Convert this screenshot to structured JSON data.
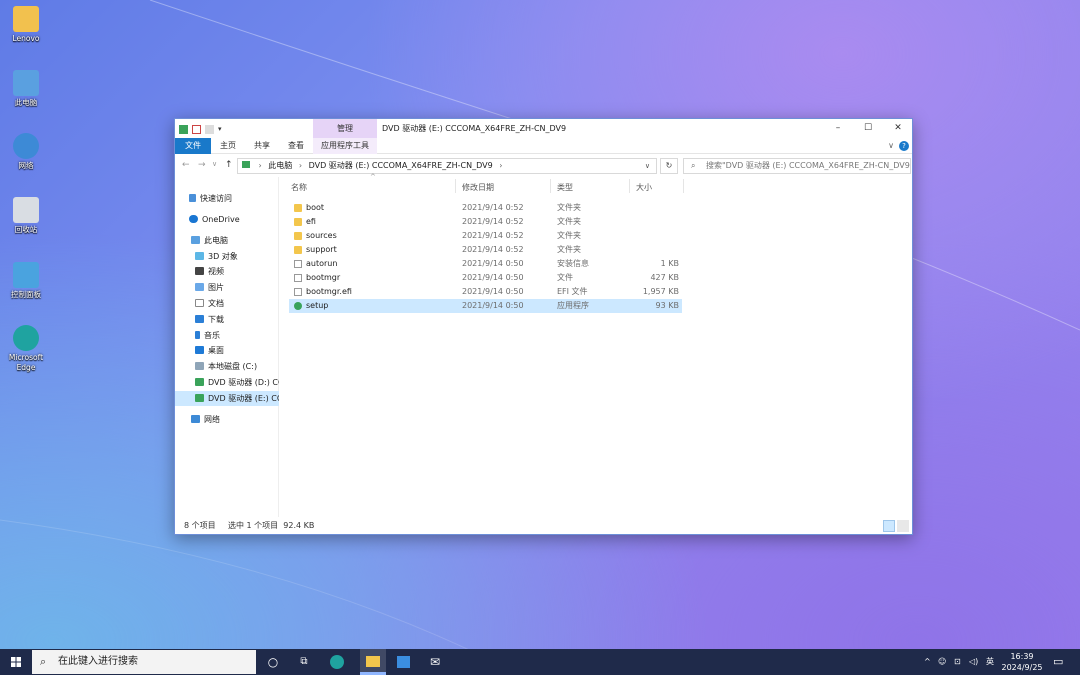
{
  "desktop": {
    "icons": [
      {
        "label": "Lenovo",
        "icon": "user-folder-icon",
        "color": "#f2c14e"
      },
      {
        "label": "此电脑",
        "icon": "computer-icon",
        "color": "#5aa0e0"
      },
      {
        "label": "网络",
        "icon": "network-globe-icon",
        "color": "#3d8ad6"
      },
      {
        "label": "回收站",
        "icon": "recycle-bin-icon",
        "color": "#d9dde3"
      },
      {
        "label": "控制面板",
        "icon": "control-panel-icon",
        "color": "#4aa3df"
      },
      {
        "label": "Microsoft Edge",
        "icon": "edge-icon",
        "color": "#1fa3a0"
      }
    ]
  },
  "window": {
    "title": "DVD 驱动器 (E:) CCCOMA_X64FRE_ZH-CN_DV9",
    "context_tab": "管理",
    "controls": {
      "minimize": "–",
      "maximize": "☐",
      "close": "✕"
    },
    "ribbon_tabs": [
      "文件",
      "主页",
      "共享",
      "查看",
      "应用程序工具"
    ],
    "ribbon_help": "?",
    "ribbon_expand": "∨",
    "address": {
      "crumbs": [
        "此电脑",
        "DVD 驱动器 (E:) CCCOMA_X64FRE_ZH-CN_DV9"
      ],
      "back": "←",
      "forward": "→",
      "recent": "∨",
      "up": "↑",
      "dropdown": "∨",
      "refresh": "↻"
    },
    "search_placeholder": "搜索\"DVD 驱动器 (E:) CCCOMA_X64FRE_ZH-CN_DV9\"",
    "nav": {
      "quick_access": "快速访问",
      "onedrive": "OneDrive",
      "this_pc": "此电脑",
      "items": [
        "3D 对象",
        "视频",
        "图片",
        "文档",
        "下载",
        "音乐",
        "桌面",
        "本地磁盘 (C:)",
        "DVD 驱动器 (D:) CC",
        "DVD 驱动器 (E:) CC"
      ],
      "network": "网络"
    },
    "columns": {
      "name": "名称",
      "modified": "修改日期",
      "type": "类型",
      "size": "大小"
    },
    "files": [
      {
        "name": "boot",
        "modified": "2021/9/14 0:52",
        "type": "文件夹",
        "size": "",
        "kind": "folder"
      },
      {
        "name": "efi",
        "modified": "2021/9/14 0:52",
        "type": "文件夹",
        "size": "",
        "kind": "folder"
      },
      {
        "name": "sources",
        "modified": "2021/9/14 0:52",
        "type": "文件夹",
        "size": "",
        "kind": "folder"
      },
      {
        "name": "support",
        "modified": "2021/9/14 0:52",
        "type": "文件夹",
        "size": "",
        "kind": "folder"
      },
      {
        "name": "autorun",
        "modified": "2021/9/14 0:50",
        "type": "安装信息",
        "size": "1 KB",
        "kind": "doc"
      },
      {
        "name": "bootmgr",
        "modified": "2021/9/14 0:50",
        "type": "文件",
        "size": "427 KB",
        "kind": "doc"
      },
      {
        "name": "bootmgr.efi",
        "modified": "2021/9/14 0:50",
        "type": "EFI 文件",
        "size": "1,957 KB",
        "kind": "doc"
      },
      {
        "name": "setup",
        "modified": "2021/9/14 0:50",
        "type": "应用程序",
        "size": "93 KB",
        "kind": "app"
      }
    ],
    "status": {
      "count": "8 个项目",
      "selected": "选中 1 个项目  92.4 KB"
    }
  },
  "taskbar": {
    "search_placeholder": "在此键入进行搜索",
    "tray": {
      "lang": "英",
      "time": "16:39",
      "date": "2024/9/25"
    }
  },
  "colors": {
    "accent": "#1979ca",
    "selection": "#cce8ff",
    "taskbar": "#1f2a4a"
  }
}
